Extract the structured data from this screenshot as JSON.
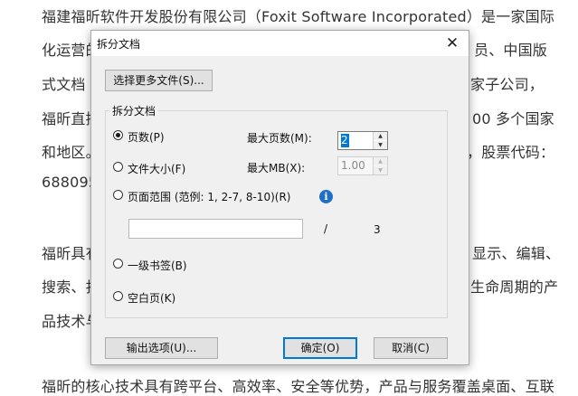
{
  "document": {
    "lines": [
      "福建福昕软件开发股份有限公司（Foxit Software Incorporated）是一家国际",
      "化运营的",
      "员、中国版",
      "式文档 (",
      "家子公司，",
      "福昕直接",
      "00 多个国家",
      "和地区。",
      "，股票代码：",
      "688095",
      "福昕具有",
      "显示、编辑、",
      "搜索、打",
      "生命周期的产",
      "品技术与",
      "福昕的核心技术具有跨平台、高效率、安全等优势，产品与服务覆盖桌面、互联"
    ]
  },
  "dialog": {
    "title": "拆分文档",
    "close_label": "✕",
    "select_more_files": "选择更多文件(S)...",
    "group_label": "拆分文档",
    "options": {
      "pages": "页数(P)",
      "file_size": "文件大小(F)",
      "page_range": "页面范围 (范例:  1, 2-7, 8-10)(R)",
      "bookmark": "一级书签(B)",
      "blank_page": "空白页(K)"
    },
    "max_pages_label": "最大页数(M):",
    "max_pages_value": "2",
    "max_mb_label": "最大MB(X):",
    "max_mb_value": "1.00",
    "page_range_value": "",
    "page_separator": "/",
    "total_pages": "3",
    "output_options": "输出选项(U)...",
    "ok": "确定(O)",
    "cancel": "取消(C)"
  }
}
